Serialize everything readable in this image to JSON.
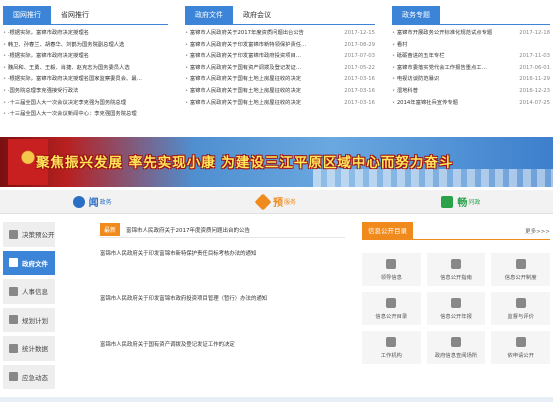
{
  "left_tabs": [
    {
      "label": "国网推行",
      "active": true
    },
    {
      "label": "省网推行",
      "active": false
    }
  ],
  "left_news": [
    {
      "text": "·根据实际，富锦市政府决定授理名"
    },
    {
      "text": "韩卫、孙春兰、胡春华、刘鹤为国务院副总理人选"
    },
    {
      "text": "·根据实际，富锦市政府决定授理名"
    },
    {
      "text": "魏凤和、王勇、王毅、肖捷、赵克志为国务委员人选"
    },
    {
      "text": "·根据实际，富锦市政府决定授理名国家监察委员会、最…"
    },
    {
      "text": "·国务院总理李克强接受行政法"
    },
    {
      "text": "·十三届全国人大一次会议决定李克强为国务院总理"
    },
    {
      "text": "·十三届全国人大一次会议新闻中心：李克强国务院总理"
    }
  ],
  "mid_tabs": [
    {
      "label": "政府文件",
      "active": true
    },
    {
      "label": "政府会议",
      "active": false
    }
  ],
  "mid_news": [
    {
      "text": "富锦市人民政府关于2017年度资质问题出台公告",
      "date": "2017-12-15"
    },
    {
      "text": "富锦市人民政府关于印发富锦市新特领保护责任…",
      "date": "2017-08-29"
    },
    {
      "text": "富锦市人民政府关于印发富锦市政府投资项目…",
      "date": "2017-07-03"
    },
    {
      "text": "富锦市人民政府关于国有资产调拨及登记发证…",
      "date": "2017-05-22"
    },
    {
      "text": "富锦市人民政府关于国有土地上房屋征收的决定",
      "date": "2017-03-16"
    },
    {
      "text": "富锦市人民政府关于国有土地上房屋征收的决定",
      "date": "2017-03-16"
    },
    {
      "text": "富锦市人民政府关于国有土地上房屋征收的决定",
      "date": "2017-03-16"
    }
  ],
  "right_tabs": [
    {
      "label": "政务专题",
      "active": true
    }
  ],
  "right_news": [
    {
      "text": "富锦市开展政务公开标准化规范试点专题",
      "date": "2017-12-18"
    },
    {
      "text": "看村",
      "date": ""
    },
    {
      "text": "砥砺奋进的五年专栏",
      "date": "2017-11-03"
    },
    {
      "text": "富锦市委落实党代会工作报告重点工…",
      "date": "2017-06-01"
    },
    {
      "text": "电视访谈防范暴识",
      "date": "2016-11-29"
    },
    {
      "text": "湿地科普",
      "date": "2016-12-23"
    },
    {
      "text": "2014年富锦社兵宣传专题",
      "date": "2014-07-25"
    }
  ],
  "banner": {
    "slogan": "聚焦振兴发展   率先实现小康   为建设三江平原区域中心而努力奋斗"
  },
  "services": [
    {
      "label": "闻",
      "sub": "政务"
    },
    {
      "label": "预",
      "sub": "服务"
    },
    {
      "label": "畅",
      "sub": "问政"
    }
  ],
  "sidebar": [
    {
      "label": "决策预公开",
      "active": false
    },
    {
      "label": "政府文件",
      "active": true
    },
    {
      "label": "人事信息",
      "active": false
    },
    {
      "label": "规划计划",
      "active": false
    },
    {
      "label": "统计数据",
      "active": false
    },
    {
      "label": "应急动态",
      "active": false
    }
  ],
  "center": {
    "badge": "最新",
    "latest": "富锦市人民政府关于2017年度资质问题出台的公告",
    "docs": [
      "富锦市人民政府关于印发富锦市新特保护责任目标考核办法的通知",
      "富锦市人民政府关于印发富锦市政府投资项目管理（暂行）办法的通知",
      "富锦市人民政府关于国有资产调拨及登记发证工作的决定"
    ]
  },
  "info": {
    "title": "信息公开目录",
    "more": "更多>>>",
    "cells": [
      "领导信息",
      "信息公开指南",
      "信息公开制度",
      "信息公开目录",
      "信息公开年报",
      "监督与评价",
      "工作机构",
      "政府信息查阅场所",
      "依申请公开"
    ]
  }
}
